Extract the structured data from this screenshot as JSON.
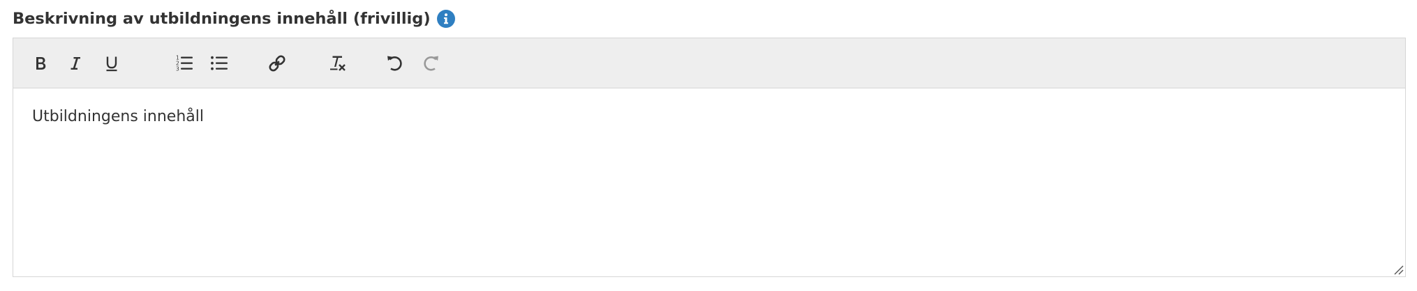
{
  "field": {
    "label": "Beskrivning av utbildningens innehåll (frivillig)",
    "info_icon": "info-circle-icon",
    "info_color": "#2f7fc1"
  },
  "toolbar": {
    "buttons": [
      {
        "name": "bold",
        "icon": "bold-icon",
        "enabled": true
      },
      {
        "name": "italic",
        "icon": "italic-icon",
        "enabled": true
      },
      {
        "name": "underline",
        "icon": "underline-icon",
        "enabled": true
      },
      {
        "name": "numbered-list",
        "icon": "numbered-list-icon",
        "enabled": true
      },
      {
        "name": "bulleted-list",
        "icon": "bulleted-list-icon",
        "enabled": true
      },
      {
        "name": "link",
        "icon": "link-icon",
        "enabled": true
      },
      {
        "name": "remove-format",
        "icon": "remove-format-icon",
        "enabled": true
      },
      {
        "name": "undo",
        "icon": "undo-icon",
        "enabled": true
      },
      {
        "name": "redo",
        "icon": "redo-icon",
        "enabled": false
      }
    ],
    "background": "#eeeeee",
    "icon_color": "#333333",
    "disabled_icon_color": "#999999"
  },
  "editor": {
    "content": "Utbildningens innehåll"
  }
}
